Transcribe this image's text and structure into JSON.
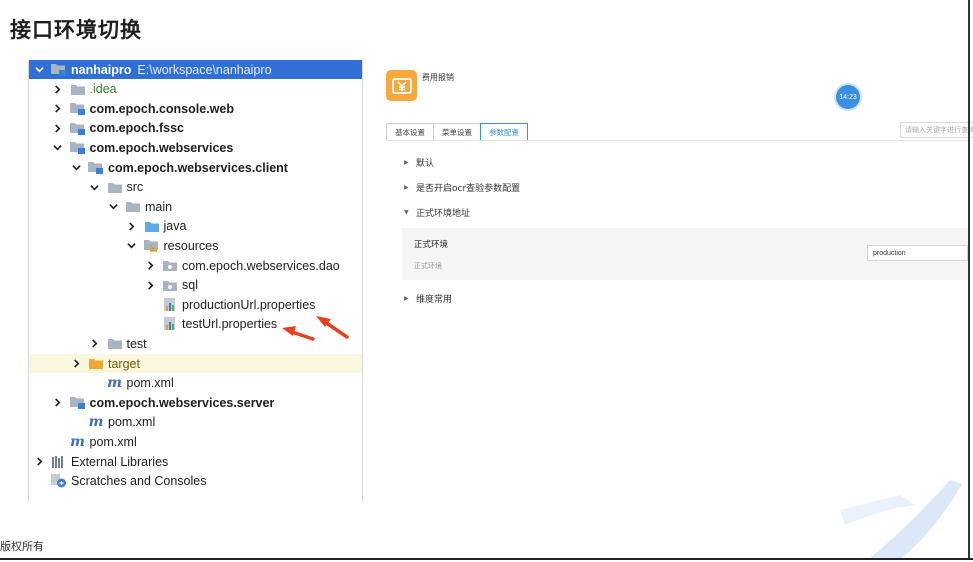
{
  "slide": {
    "title": "接口环境切换",
    "footer": "版权所有"
  },
  "ide": {
    "tree": [
      {
        "depth": 0,
        "chevron": "down",
        "icon": "module-folder",
        "label": "nanhaipro",
        "hint": "E:\\workspace\\nanhaipro",
        "bold": true,
        "state": "selected"
      },
      {
        "depth": 1,
        "chevron": "right",
        "icon": "folder",
        "label": ".idea",
        "style": "green"
      },
      {
        "depth": 1,
        "chevron": "right",
        "icon": "module-folder",
        "label": "com.epoch.console.web",
        "bold": true
      },
      {
        "depth": 1,
        "chevron": "right",
        "icon": "module-folder",
        "label": "com.epoch.fssc",
        "bold": true
      },
      {
        "depth": 1,
        "chevron": "down",
        "icon": "module-folder",
        "label": "com.epoch.webservices",
        "bold": true
      },
      {
        "depth": 2,
        "chevron": "down",
        "icon": "module-folder",
        "label": "com.epoch.webservices.client",
        "bold": true
      },
      {
        "depth": 3,
        "chevron": "down",
        "icon": "folder",
        "label": "src"
      },
      {
        "depth": 4,
        "chevron": "down",
        "icon": "folder",
        "label": "main"
      },
      {
        "depth": 5,
        "chevron": "right",
        "icon": "source-folder",
        "label": "java"
      },
      {
        "depth": 5,
        "chevron": "down",
        "icon": "resources-folder",
        "label": "resources"
      },
      {
        "depth": 6,
        "chevron": "right",
        "icon": "package-folder",
        "label": "com.epoch.webservices.dao"
      },
      {
        "depth": 6,
        "chevron": "right",
        "icon": "package-folder",
        "label": "sql"
      },
      {
        "depth": 6,
        "chevron": "none",
        "icon": "properties-file",
        "label": "productionUrl.properties"
      },
      {
        "depth": 6,
        "chevron": "none",
        "icon": "properties-file",
        "label": "testUrl.properties"
      },
      {
        "depth": 3,
        "chevron": "right",
        "icon": "folder",
        "label": "test"
      },
      {
        "depth": 2,
        "chevron": "right",
        "icon": "excluded-folder",
        "label": "target",
        "style": "orange",
        "state": "excluded"
      },
      {
        "depth": 3,
        "chevron": "none",
        "icon": "maven-file",
        "label": "pom.xml"
      },
      {
        "depth": 1,
        "chevron": "right",
        "icon": "module-folder",
        "label": "com.epoch.webservices.server",
        "bold": true
      },
      {
        "depth": 2,
        "chevron": "none",
        "icon": "maven-file",
        "label": "pom.xml"
      },
      {
        "depth": 1,
        "chevron": "none",
        "icon": "maven-file",
        "label": "pom.xml"
      },
      {
        "depth": 0,
        "chevron": "right",
        "icon": "library-icon",
        "label": "External Libraries"
      },
      {
        "depth": 0,
        "chevron": "none",
        "icon": "scratches-icon",
        "label": "Scratches and Consoles"
      }
    ]
  },
  "panel": {
    "app_name": "费用报销",
    "time_badge": "14:23",
    "tabs": [
      {
        "label": "基本设置",
        "active": false
      },
      {
        "label": "菜单设置",
        "active": false
      },
      {
        "label": "参数配置",
        "active": true
      }
    ],
    "search_placeholder": "请输入关键字进行查询",
    "sections": [
      {
        "label": "默认",
        "expanded": false
      },
      {
        "label": "是否开启ocr查验参数配置",
        "expanded": false
      },
      {
        "label": "正式环境地址",
        "expanded": true
      },
      {
        "label": "维度常用",
        "expanded": false
      }
    ],
    "field": {
      "label": "正式环境",
      "sub": "正式环境",
      "value": "production"
    }
  },
  "colors": {
    "selected_row": "#2f6fd6",
    "accent": "#3b8fe0",
    "app_icon": "#f7a83c",
    "arrow": "#e8401c"
  }
}
